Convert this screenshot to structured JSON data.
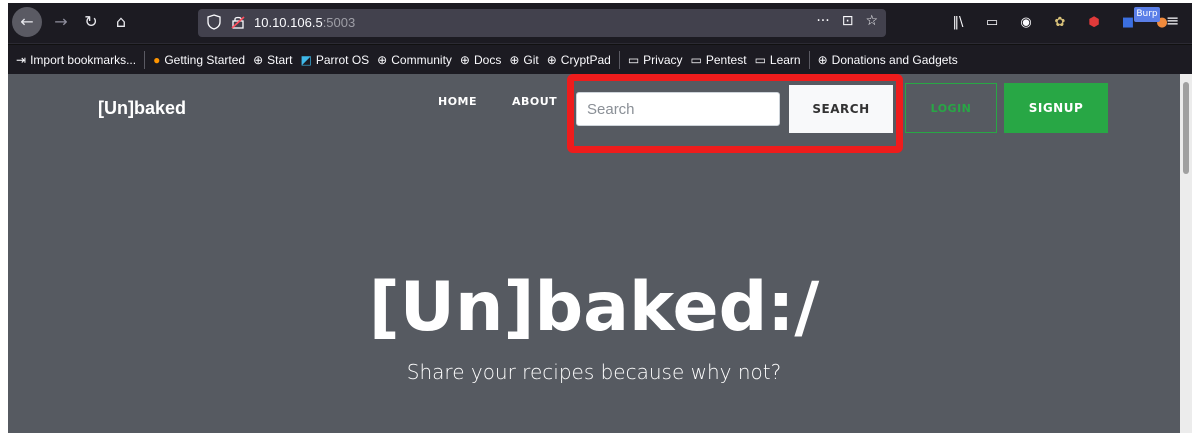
{
  "browser": {
    "url_host": "10.10.106.5",
    "url_port": ":5003",
    "url_actions": [
      "···",
      "⊡",
      "☆"
    ],
    "burp_label": "Burp",
    "icons": [
      "back-icon",
      "forward-icon",
      "reload-icon",
      "home-icon",
      "shield-icon",
      "lock-icon",
      "library-icon",
      "sidebar-icon",
      "account-icon",
      "extension-icon",
      "ublock-icon",
      "extension-blue-icon",
      "burp-icon",
      "menu-icon"
    ]
  },
  "bookmarks": [
    {
      "label": "Import bookmarks...",
      "icon": "import-icon"
    },
    {
      "label": "Getting Started",
      "icon": "firefox-icon"
    },
    {
      "label": "Start",
      "icon": "globe-icon"
    },
    {
      "label": "Parrot OS",
      "icon": "parrot-icon"
    },
    {
      "label": "Community",
      "icon": "globe-icon"
    },
    {
      "label": "Docs",
      "icon": "globe-icon"
    },
    {
      "label": "Git",
      "icon": "globe-icon"
    },
    {
      "label": "CryptPad",
      "icon": "globe-icon"
    },
    {
      "label": "Privacy",
      "icon": "folder-icon"
    },
    {
      "label": "Pentest",
      "icon": "folder-icon"
    },
    {
      "label": "Learn",
      "icon": "folder-icon"
    },
    {
      "label": "Donations and Gadgets",
      "icon": "globe-icon"
    }
  ],
  "site": {
    "brand": "[Un]baked",
    "nav": {
      "home": "HOME",
      "about": "ABOUT"
    },
    "search_placeholder": "Search",
    "search_button": "SEARCH",
    "login_button": "LOGIN",
    "signup_button": "SIGNUP",
    "hero_title": "[Un]baked:/",
    "hero_subtitle": "Share your recipes because why not?"
  },
  "colors": {
    "page_bg": "#565a61",
    "accent_green": "#28a745",
    "highlight_red": "#ee1c1c"
  }
}
